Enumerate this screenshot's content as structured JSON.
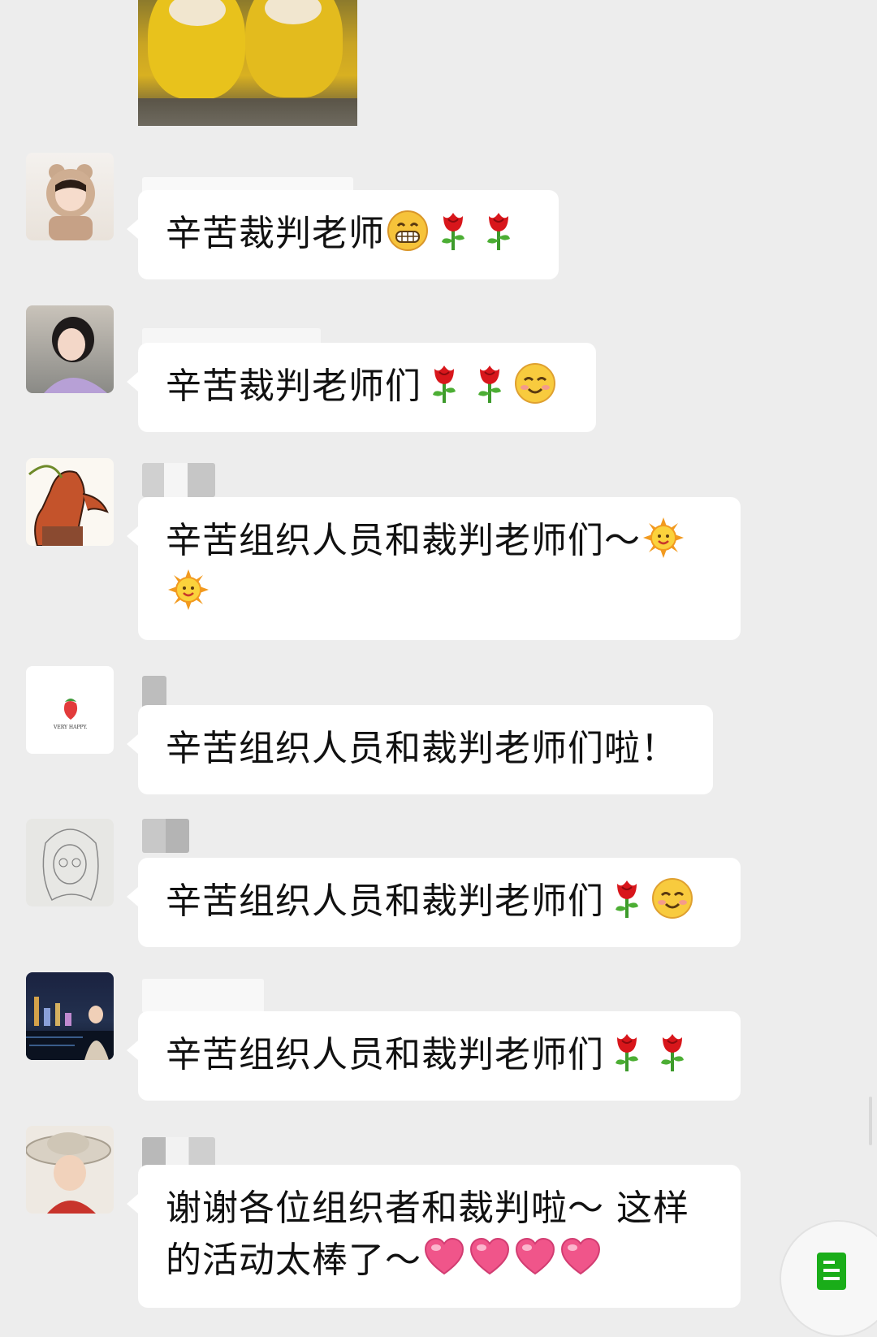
{
  "messages": [
    {
      "text": "辛苦裁判老师",
      "emojis": [
        "grin-icon",
        "rose-icon",
        "rose-icon"
      ]
    },
    {
      "text": "辛苦裁判老师们",
      "emojis": [
        "rose-icon",
        "rose-icon",
        "blush-icon"
      ]
    },
    {
      "line1": "辛苦组织人员和裁判老师们～",
      "emojis_inline": [
        "sun-icon"
      ],
      "emojis_line2": [
        "sun-icon"
      ]
    },
    {
      "text": "辛苦组织人员和裁判老师们啦！"
    },
    {
      "text": "辛苦组织人员和裁判老师们",
      "emojis": [
        "rose-icon",
        "blush-icon"
      ]
    },
    {
      "text": "辛苦组织人员和裁判老师们",
      "emojis": [
        "rose-icon",
        "rose-icon"
      ]
    },
    {
      "line1": "谢谢各位组织者和裁判啦～ 这样",
      "line2": "的活动太棒了～",
      "emojis_line2": [
        "heart-icon",
        "heart-icon",
        "heart-icon",
        "heart-icon"
      ]
    }
  ],
  "avatars": [
    "avatar-girl-bear-hood",
    "avatar-girl-purple",
    "avatar-drawn-redhead",
    "avatar-strawberry",
    "avatar-sketch-girl",
    "avatar-night-city",
    "avatar-straw-hat"
  ],
  "avatar_texts": {
    "strawberry": "VERY HAPPY."
  },
  "colors": {
    "background": "#ededed",
    "bubble": "#ffffff",
    "text": "#111111",
    "fab_icon": "#1aad19"
  },
  "floating_button": "document-icon"
}
